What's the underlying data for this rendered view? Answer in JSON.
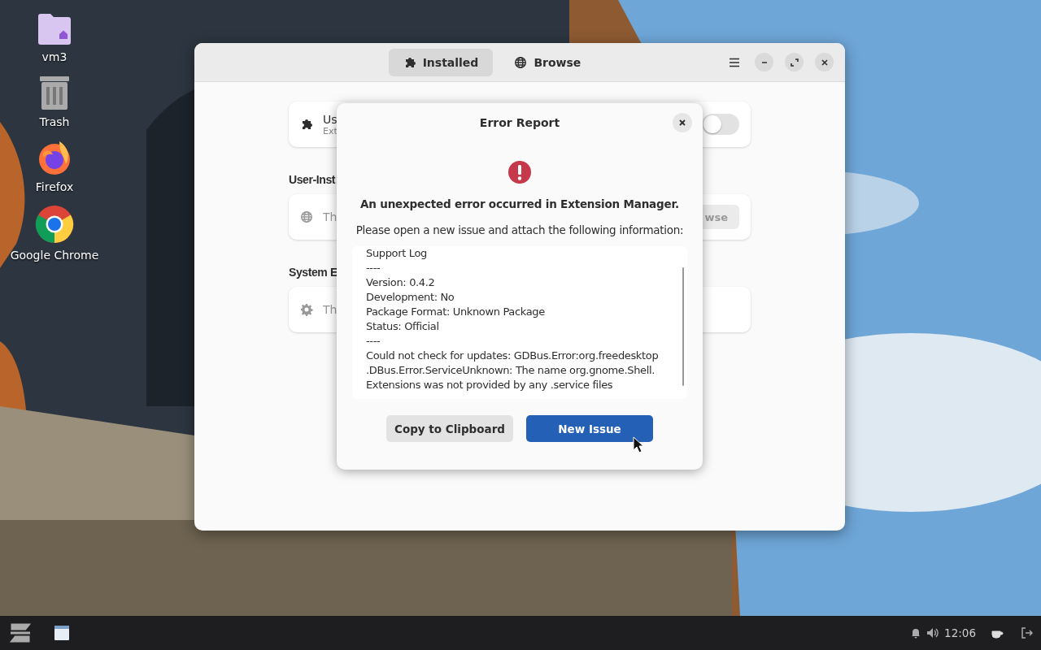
{
  "desktop": {
    "kind": "picture",
    "icons": [
      {
        "kind": "home-folder",
        "label": "vm3"
      },
      {
        "kind": "trash",
        "label": "Trash"
      },
      {
        "kind": "firefox",
        "label": "Firefox"
      },
      {
        "kind": "chrome",
        "label": "Google Chrome"
      }
    ]
  },
  "window": {
    "tabs": [
      {
        "kind": "puzzle",
        "label": "Installed",
        "selected": true
      },
      {
        "kind": "globe",
        "label": "Browse",
        "selected": false
      }
    ],
    "top_card": {
      "kind": "puzzle",
      "title": "Us",
      "subtitle": "Ext",
      "on": false
    },
    "sections": [
      {
        "heading": "User-Inst",
        "card": {
          "kind": "globe",
          "text": "Th",
          "button": "wse"
        }
      },
      {
        "heading": "System E",
        "card": {
          "kind": "gear",
          "text": "Th"
        }
      }
    ]
  },
  "dialog": {
    "title": "Error Report",
    "heading": "An unexpected error occurred in Extension Manager.",
    "message": "Please open a new issue and attach the following information:",
    "log": [
      "Support Log",
      "----",
      "Version: 0.4.2",
      "Development: No",
      "Package Format: Unknown Package",
      "Status: Official",
      "----",
      "Could not check for updates: GDBus.Error:org.freedesktop",
      ".DBus.Error.ServiceUnknown: The name org.gnome.Shell.",
      "Extensions was not provided by any .service files"
    ],
    "buttons": [
      {
        "label": "Copy to Clipboard",
        "kind": "secondary"
      },
      {
        "label": "New Issue",
        "kind": "primary"
      }
    ]
  },
  "taskbar": {
    "clock": "12:06"
  }
}
